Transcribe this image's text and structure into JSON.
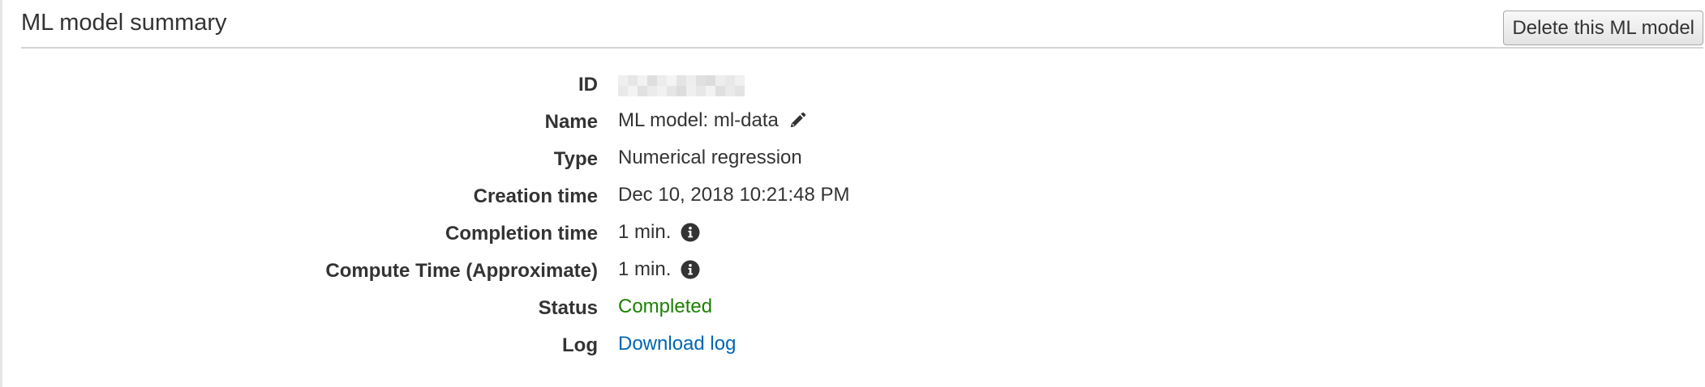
{
  "header": {
    "title": "ML model summary",
    "delete_button_label": "Delete this ML model"
  },
  "details": {
    "id": {
      "label": "ID",
      "value": ""
    },
    "name": {
      "label": "Name",
      "value": "ML model: ml-data",
      "edit_icon": "pencil-icon"
    },
    "type": {
      "label": "Type",
      "value": "Numerical regression"
    },
    "creation_time": {
      "label": "Creation time",
      "value": "Dec 10, 2018 10:21:48 PM"
    },
    "completion_time": {
      "label": "Completion time",
      "value": "1 min.",
      "info_icon": "info-icon"
    },
    "compute_time": {
      "label": "Compute Time (Approximate)",
      "value": "1 min.",
      "info_icon": "info-icon"
    },
    "status": {
      "label": "Status",
      "value": "Completed",
      "color": "#1d8102"
    },
    "log": {
      "label": "Log",
      "link_text": "Download log",
      "link_color": "#0066b3"
    }
  },
  "colors": {
    "divider": "#d5d5d5",
    "text": "#333333",
    "success": "#1d8102",
    "link": "#0066b3"
  }
}
